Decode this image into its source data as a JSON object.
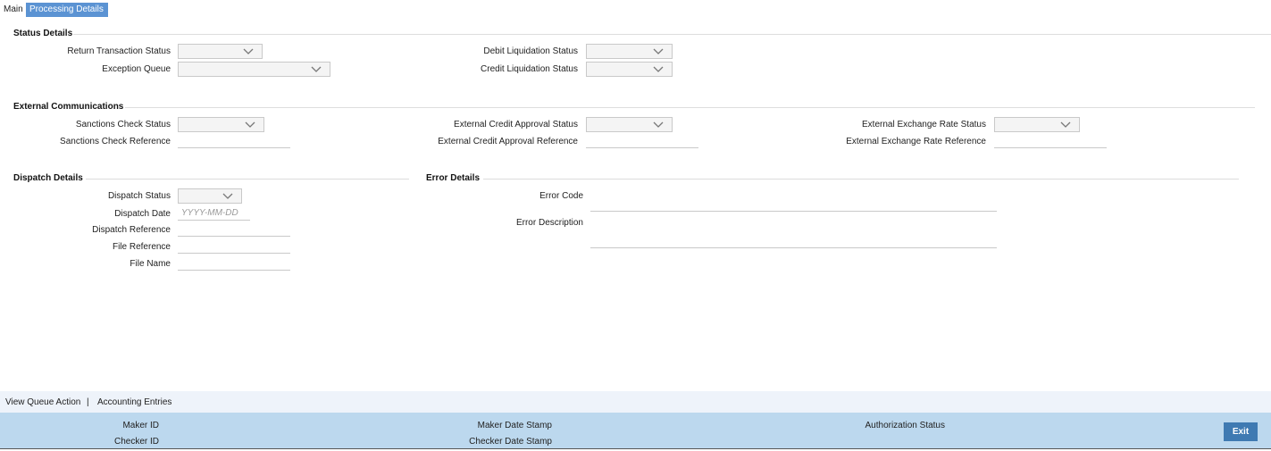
{
  "tabs": [
    {
      "label": "Main"
    },
    {
      "label": "Processing Details"
    }
  ],
  "status_details": {
    "title": "Status Details",
    "return_transaction_status": {
      "label": "Return Transaction Status",
      "value": ""
    },
    "exception_queue": {
      "label": "Exception Queue",
      "value": ""
    },
    "debit_liquidation_status": {
      "label": "Debit Liquidation Status",
      "value": ""
    },
    "credit_liquidation_status": {
      "label": "Credit Liquidation Status",
      "value": ""
    }
  },
  "external_communications": {
    "title": "External Communications",
    "sanctions_check_status": {
      "label": "Sanctions Check Status",
      "value": ""
    },
    "sanctions_check_reference": {
      "label": "Sanctions Check Reference",
      "value": ""
    },
    "external_credit_approval_status": {
      "label": "External Credit Approval Status",
      "value": ""
    },
    "external_credit_approval_reference": {
      "label": "External Credit Approval Reference",
      "value": ""
    },
    "external_exchange_rate_status": {
      "label": "External Exchange Rate Status",
      "value": ""
    },
    "external_exchange_rate_reference": {
      "label": "External Exchange Rate Reference",
      "value": ""
    }
  },
  "dispatch_details": {
    "title": "Dispatch Details",
    "dispatch_status": {
      "label": "Dispatch Status",
      "value": ""
    },
    "dispatch_date": {
      "label": "Dispatch Date",
      "value": "",
      "placeholder": "YYYY-MM-DD"
    },
    "dispatch_reference": {
      "label": "Dispatch Reference",
      "value": ""
    },
    "file_reference": {
      "label": "File Reference",
      "value": ""
    },
    "file_name": {
      "label": "File Name",
      "value": ""
    }
  },
  "error_details": {
    "title": "Error Details",
    "error_code": {
      "label": "Error Code",
      "value": ""
    },
    "error_description": {
      "label": "Error Description",
      "value": ""
    }
  },
  "footer_links": {
    "view_queue_action": "View Queue Action",
    "separator": "|",
    "accounting_entries": "Accounting Entries"
  },
  "audit": {
    "maker_id": "Maker ID",
    "checker_id": "Checker ID",
    "maker_date_stamp": "Maker Date Stamp",
    "checker_date_stamp": "Checker Date Stamp",
    "authorization_status": "Authorization Status",
    "exit_label": "Exit"
  },
  "colors": {
    "active_tab": "#5b93d3",
    "audit_bar": "#bcd8ee",
    "links_bar": "#eef3fa",
    "exit_button": "#3f7ab2"
  }
}
